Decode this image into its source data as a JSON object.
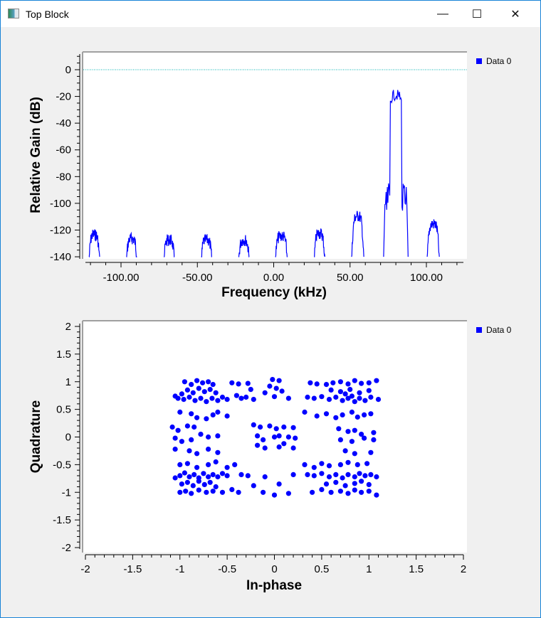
{
  "window": {
    "title": "Top Block",
    "controls": {
      "minimize": "—",
      "maximize": "☐",
      "close": "✕"
    }
  },
  "chart_data": [
    {
      "type": "line",
      "title": "",
      "xlabel": "Frequency (kHz)",
      "ylabel": "Relative Gain (dB)",
      "xlim": [
        -125,
        125
      ],
      "ylim": [
        -140,
        12
      ],
      "x_ticks": [
        -100,
        -50,
        0,
        50,
        100
      ],
      "x_tick_labels": [
        "-100.00",
        "-50.00",
        "0.00",
        "50.00",
        "100.00"
      ],
      "y_ticks": [
        0,
        -20,
        -40,
        -60,
        -80,
        -100,
        -120,
        -140
      ],
      "y_tick_labels": [
        "0",
        "-20",
        "-40",
        "-60",
        "-80",
        "-100",
        "-120",
        "-140"
      ],
      "legend": {
        "entries": [
          "Data 0"
        ],
        "placement": "top-right-outside",
        "color": "#0000ff"
      },
      "reference_line": {
        "y": 0,
        "color": "#00b0b0",
        "style": "dotted"
      },
      "series": [
        {
          "name": "Data 0",
          "color": "#0000ff",
          "lobes": [
            {
              "center": -117.5,
              "width": 7,
              "peak": -119
            },
            {
              "center": -93,
              "width": 7,
              "peak": -122
            },
            {
              "center": -68.5,
              "width": 7,
              "peak": -123
            },
            {
              "center": -44,
              "width": 7,
              "peak": -123
            },
            {
              "center": -19.5,
              "width": 7,
              "peak": -123
            },
            {
              "center": 5,
              "width": 8,
              "peak": -120
            },
            {
              "center": 30,
              "width": 7,
              "peak": -118
            },
            {
              "center": 55,
              "width": 8,
              "peak": -105
            },
            {
              "center": 80,
              "width": 16,
              "peak": -15
            },
            {
              "center": 104.5,
              "width": 8,
              "peak": -111
            }
          ],
          "floor": -140
        }
      ]
    },
    {
      "type": "scatter",
      "title": "",
      "xlabel": "In-phase",
      "ylabel": "Quadrature",
      "xlim": [
        -2,
        2
      ],
      "ylim": [
        -2,
        2
      ],
      "x_ticks": [
        -2,
        -1.5,
        -1,
        -0.5,
        0,
        0.5,
        1,
        1.5,
        2
      ],
      "x_tick_labels": [
        "-2",
        "-1.5",
        "-1",
        "-0.5",
        "0",
        "0.5",
        "1",
        "1.5",
        "2"
      ],
      "y_ticks": [
        2,
        1.5,
        1,
        0.5,
        0,
        -0.5,
        -1,
        -1.5,
        -2
      ],
      "y_tick_labels": [
        "2",
        "1.5",
        "1",
        "0.5",
        "0",
        "-0.5",
        "-1",
        "-1.5",
        "-2"
      ],
      "legend": {
        "entries": [
          "Data 0"
        ],
        "placement": "top-right-outside",
        "color": "#0000ff"
      },
      "series": [
        {
          "name": "Data 0",
          "color": "#0000ff",
          "points": [
            [
              -0.95,
              1.0
            ],
            [
              -0.88,
              0.95
            ],
            [
              -0.82,
              1.02
            ],
            [
              -0.76,
              0.98
            ],
            [
              -0.7,
              1.0
            ],
            [
              -0.65,
              0.95
            ],
            [
              -0.92,
              0.85
            ],
            [
              -0.86,
              0.8
            ],
            [
              -0.8,
              0.88
            ],
            [
              -0.74,
              0.82
            ],
            [
              -0.68,
              0.86
            ],
            [
              -0.62,
              0.8
            ],
            [
              -1.02,
              0.7
            ],
            [
              -0.96,
              0.68
            ],
            [
              -0.9,
              0.72
            ],
            [
              -0.84,
              0.66
            ],
            [
              -0.78,
              0.7
            ],
            [
              -0.72,
              0.64
            ],
            [
              -0.66,
              0.7
            ],
            [
              -0.6,
              0.66
            ],
            [
              -0.55,
              0.72
            ],
            [
              -0.5,
              0.68
            ],
            [
              -1.05,
              0.74
            ],
            [
              -0.98,
              0.78
            ],
            [
              -0.45,
              0.98
            ],
            [
              -0.38,
              0.96
            ],
            [
              -0.28,
              0.97
            ],
            [
              -0.25,
              0.86
            ],
            [
              -0.4,
              0.75
            ],
            [
              -0.35,
              0.7
            ],
            [
              -0.3,
              0.72
            ],
            [
              -0.22,
              0.68
            ],
            [
              -0.02,
              1.04
            ],
            [
              0.05,
              1.02
            ],
            [
              -0.05,
              0.92
            ],
            [
              0.02,
              0.88
            ],
            [
              -0.1,
              0.8
            ],
            [
              0.08,
              0.83
            ],
            [
              0.0,
              0.73
            ],
            [
              0.15,
              0.7
            ],
            [
              0.38,
              0.98
            ],
            [
              0.45,
              0.96
            ],
            [
              0.55,
              0.95
            ],
            [
              0.62,
              0.98
            ],
            [
              0.7,
              1.0
            ],
            [
              0.78,
              0.96
            ],
            [
              0.85,
              1.02
            ],
            [
              0.92,
              0.97
            ],
            [
              1.0,
              0.98
            ],
            [
              1.08,
              1.02
            ],
            [
              0.35,
              0.72
            ],
            [
              0.42,
              0.7
            ],
            [
              0.5,
              0.73
            ],
            [
              0.58,
              0.68
            ],
            [
              0.65,
              0.72
            ],
            [
              0.72,
              0.66
            ],
            [
              0.78,
              0.7
            ],
            [
              0.85,
              0.64
            ],
            [
              0.9,
              0.7
            ],
            [
              0.96,
              0.66
            ],
            [
              1.02,
              0.72
            ],
            [
              1.1,
              0.68
            ],
            [
              0.6,
              0.85
            ],
            [
              0.7,
              0.82
            ],
            [
              0.8,
              0.86
            ],
            [
              0.9,
              0.8
            ],
            [
              1.0,
              0.84
            ],
            [
              0.75,
              0.78
            ],
            [
              0.82,
              0.74
            ],
            [
              -1.0,
              0.45
            ],
            [
              -0.88,
              0.42
            ],
            [
              -0.82,
              0.35
            ],
            [
              -0.72,
              0.33
            ],
            [
              -0.65,
              0.4
            ],
            [
              -0.6,
              0.45
            ],
            [
              -0.5,
              0.38
            ],
            [
              -1.08,
              0.18
            ],
            [
              -1.02,
              0.12
            ],
            [
              -0.92,
              0.2
            ],
            [
              -0.85,
              0.18
            ],
            [
              -1.05,
              -0.02
            ],
            [
              -0.98,
              -0.08
            ],
            [
              -0.88,
              -0.05
            ],
            [
              -0.78,
              0.05
            ],
            [
              -0.7,
              0.0
            ],
            [
              -0.6,
              0.02
            ],
            [
              -1.05,
              -0.22
            ],
            [
              -0.9,
              -0.25
            ],
            [
              -0.82,
              -0.3
            ],
            [
              -0.7,
              -0.22
            ],
            [
              -0.6,
              -0.28
            ],
            [
              -0.22,
              0.22
            ],
            [
              -0.15,
              0.18
            ],
            [
              -0.05,
              0.2
            ],
            [
              0.02,
              0.15
            ],
            [
              0.1,
              0.18
            ],
            [
              0.2,
              0.17
            ],
            [
              -0.18,
              0.02
            ],
            [
              -0.12,
              -0.05
            ],
            [
              0.0,
              0.0
            ],
            [
              0.05,
              0.02
            ],
            [
              0.15,
              0.0
            ],
            [
              0.22,
              -0.02
            ],
            [
              -0.18,
              -0.15
            ],
            [
              -0.1,
              -0.2
            ],
            [
              0.05,
              -0.18
            ],
            [
              0.1,
              -0.12
            ],
            [
              0.2,
              -0.2
            ],
            [
              0.32,
              0.45
            ],
            [
              0.45,
              0.38
            ],
            [
              0.55,
              0.42
            ],
            [
              0.65,
              0.35
            ],
            [
              0.72,
              0.4
            ],
            [
              0.82,
              0.45
            ],
            [
              0.88,
              0.36
            ],
            [
              0.95,
              0.4
            ],
            [
              1.02,
              0.42
            ],
            [
              0.68,
              0.15
            ],
            [
              0.78,
              0.1
            ],
            [
              0.85,
              0.12
            ],
            [
              0.92,
              0.05
            ],
            [
              1.05,
              0.08
            ],
            [
              0.7,
              -0.05
            ],
            [
              0.82,
              -0.08
            ],
            [
              0.95,
              -0.02
            ],
            [
              1.05,
              -0.05
            ],
            [
              0.75,
              -0.25
            ],
            [
              0.85,
              -0.3
            ],
            [
              1.02,
              -0.28
            ],
            [
              -1.0,
              -0.5
            ],
            [
              -0.92,
              -0.48
            ],
            [
              -0.82,
              -0.55
            ],
            [
              -0.7,
              -0.5
            ],
            [
              -0.62,
              -0.45
            ],
            [
              -0.5,
              -0.55
            ],
            [
              -0.42,
              -0.5
            ],
            [
              -1.0,
              -0.7
            ],
            [
              -0.95,
              -0.65
            ],
            [
              -0.9,
              -0.72
            ],
            [
              -0.85,
              -0.68
            ],
            [
              -0.8,
              -0.74
            ],
            [
              -0.75,
              -0.66
            ],
            [
              -0.7,
              -0.72
            ],
            [
              -0.65,
              -0.68
            ],
            [
              -0.6,
              -0.72
            ],
            [
              -0.55,
              -0.66
            ],
            [
              -0.5,
              -0.7
            ],
            [
              -1.05,
              -0.74
            ],
            [
              -0.98,
              -0.85
            ],
            [
              -0.92,
              -0.82
            ],
            [
              -0.86,
              -0.88
            ],
            [
              -0.8,
              -0.8
            ],
            [
              -0.74,
              -0.86
            ],
            [
              -0.68,
              -0.82
            ],
            [
              -0.62,
              -0.9
            ],
            [
              -1.0,
              -1.0
            ],
            [
              -0.94,
              -0.98
            ],
            [
              -0.88,
              -1.02
            ],
            [
              -0.8,
              -0.96
            ],
            [
              -0.72,
              -1.0
            ],
            [
              -0.65,
              -0.98
            ],
            [
              -0.55,
              -1.0
            ],
            [
              -0.45,
              -0.95
            ],
            [
              -0.38,
              -1.0
            ],
            [
              -0.35,
              -0.68
            ],
            [
              -0.28,
              -0.7
            ],
            [
              -0.22,
              -0.88
            ],
            [
              -0.1,
              -0.72
            ],
            [
              -0.12,
              -1.0
            ],
            [
              0.0,
              -1.05
            ],
            [
              0.05,
              -0.85
            ],
            [
              0.15,
              -1.02
            ],
            [
              0.2,
              -0.68
            ],
            [
              0.32,
              -0.5
            ],
            [
              0.42,
              -0.55
            ],
            [
              0.5,
              -0.48
            ],
            [
              0.58,
              -0.52
            ],
            [
              0.7,
              -0.5
            ],
            [
              0.78,
              -0.46
            ],
            [
              0.88,
              -0.5
            ],
            [
              0.98,
              -0.48
            ],
            [
              0.35,
              -0.68
            ],
            [
              0.42,
              -0.7
            ],
            [
              0.5,
              -0.66
            ],
            [
              0.58,
              -0.72
            ],
            [
              0.65,
              -0.68
            ],
            [
              0.72,
              -0.74
            ],
            [
              0.78,
              -0.68
            ],
            [
              0.85,
              -0.72
            ],
            [
              0.9,
              -0.66
            ],
            [
              0.96,
              -0.7
            ],
            [
              1.02,
              -0.68
            ],
            [
              1.08,
              -0.72
            ],
            [
              0.55,
              -0.85
            ],
            [
              0.65,
              -0.82
            ],
            [
              0.75,
              -0.88
            ],
            [
              0.85,
              -0.84
            ],
            [
              0.92,
              -0.8
            ],
            [
              1.0,
              -0.86
            ],
            [
              0.4,
              -1.0
            ],
            [
              0.5,
              -0.95
            ],
            [
              0.6,
              -1.0
            ],
            [
              0.7,
              -0.98
            ],
            [
              0.78,
              -1.02
            ],
            [
              0.85,
              -0.96
            ],
            [
              0.92,
              -1.0
            ],
            [
              1.0,
              -0.98
            ],
            [
              1.08,
              -1.05
            ]
          ]
        }
      ]
    }
  ]
}
